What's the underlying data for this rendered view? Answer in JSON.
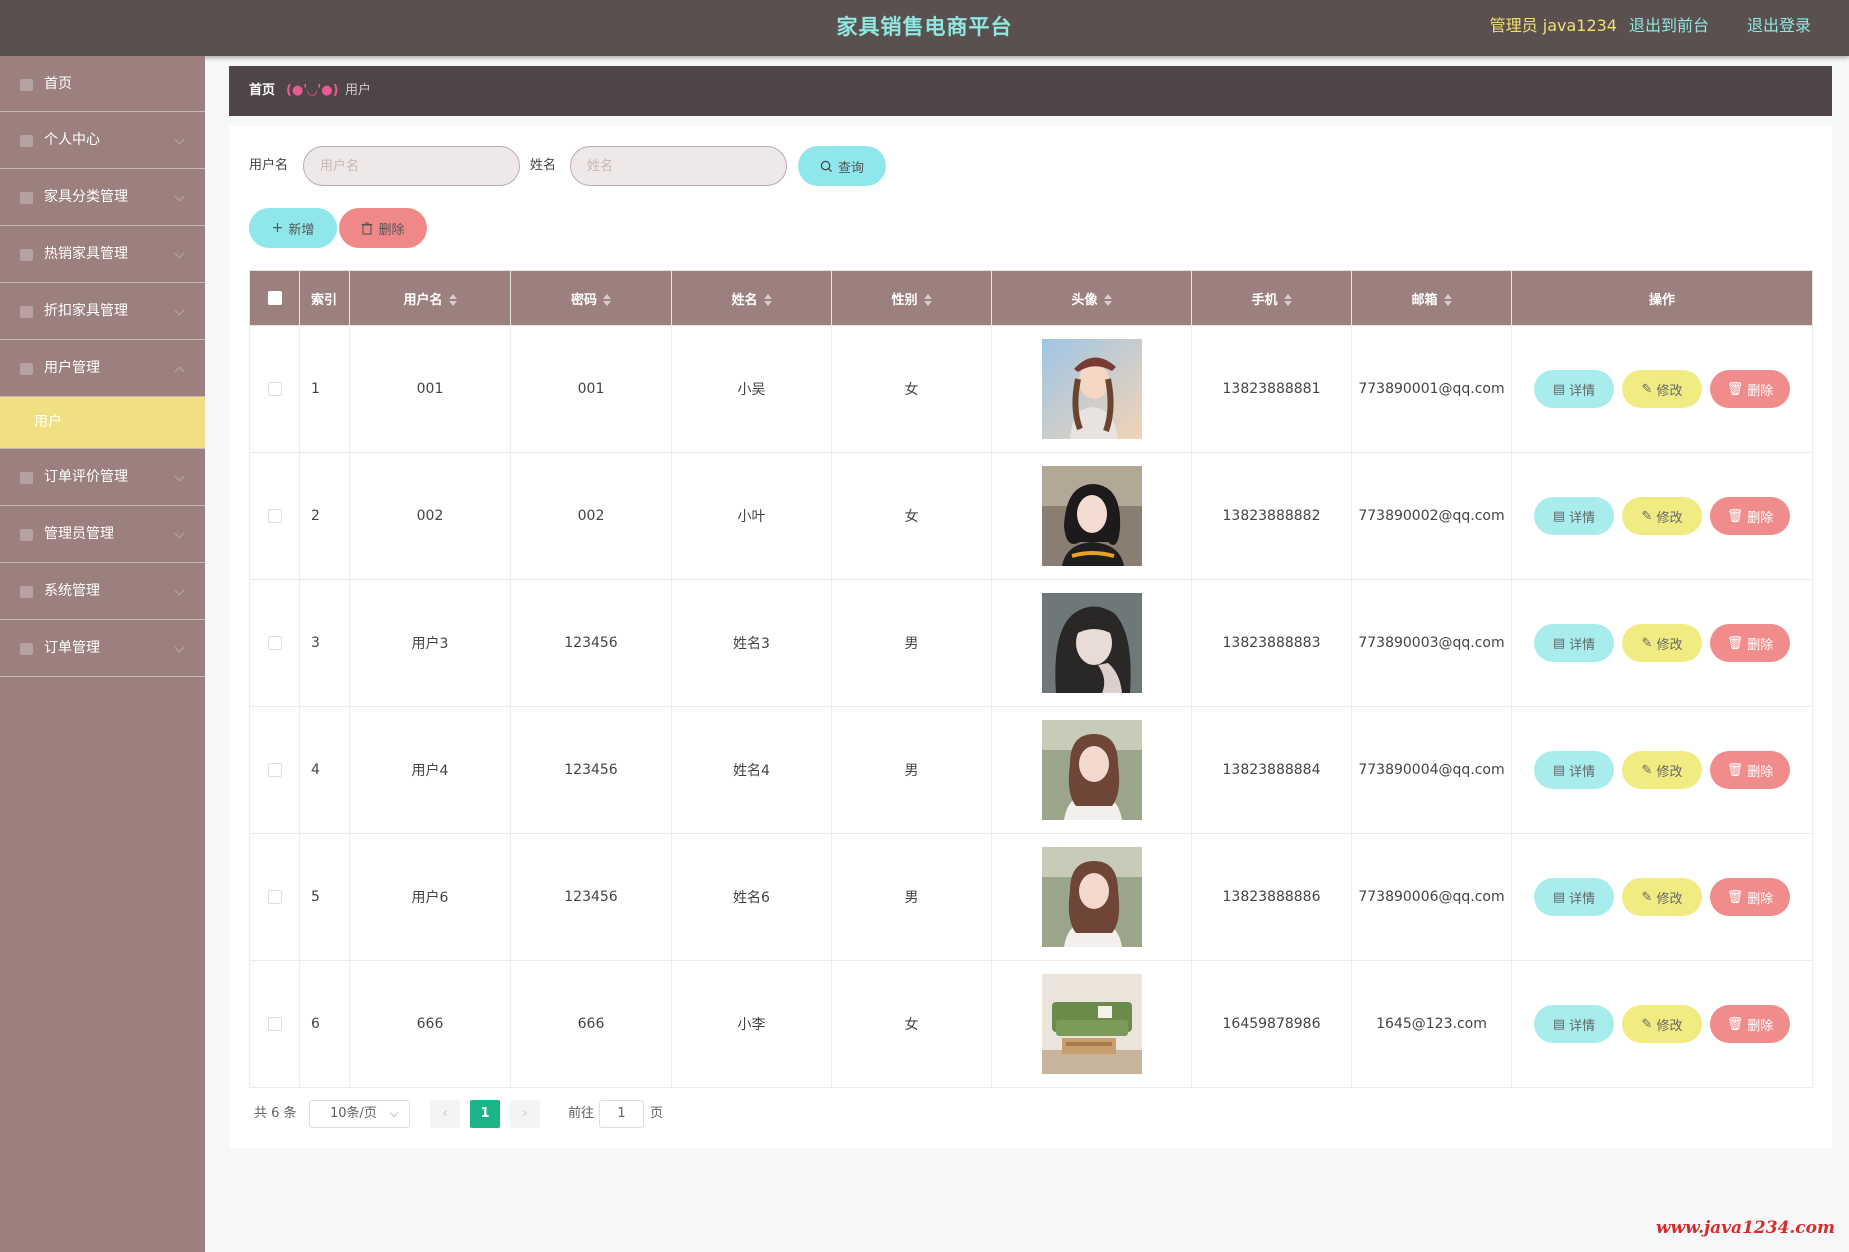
{
  "header": {
    "title": "家具销售电商平台",
    "admin_label": "管理员 java1234",
    "front_link": "退出到前台",
    "logout_link": "退出登录"
  },
  "sidebar": {
    "items": [
      {
        "label": "首页"
      },
      {
        "label": "个人中心"
      },
      {
        "label": "家具分类管理"
      },
      {
        "label": "热销家具管理"
      },
      {
        "label": "折扣家具管理"
      },
      {
        "label": "用户管理"
      },
      {
        "label": "订单评价管理"
      },
      {
        "label": "管理员管理"
      },
      {
        "label": "系统管理"
      },
      {
        "label": "订单管理"
      }
    ],
    "sub_active": "用户"
  },
  "breadcrumb": {
    "home": "首页",
    "separator": "(●'◡'●)",
    "current": "用户"
  },
  "search": {
    "username_label": "用户名",
    "username_placeholder": "用户名",
    "name_label": "姓名",
    "name_placeholder": "姓名",
    "query_label": "查询"
  },
  "actions": {
    "add_label": "新增",
    "delete_label": "删除"
  },
  "table": {
    "headers": {
      "index": "索引",
      "username": "用户名",
      "password": "密码",
      "name": "姓名",
      "gender": "性别",
      "avatar": "头像",
      "phone": "手机",
      "email": "邮箱",
      "ops": "操作"
    },
    "rows": [
      {
        "index": "1",
        "username": "001",
        "password": "001",
        "name": "小吴",
        "gender": "女",
        "phone": "13823888881",
        "email": "773890001@qq.com"
      },
      {
        "index": "2",
        "username": "002",
        "password": "002",
        "name": "小叶",
        "gender": "女",
        "phone": "13823888882",
        "email": "773890002@qq.com"
      },
      {
        "index": "3",
        "username": "用户3",
        "password": "123456",
        "name": "姓名3",
        "gender": "男",
        "phone": "13823888883",
        "email": "773890003@qq.com"
      },
      {
        "index": "4",
        "username": "用户4",
        "password": "123456",
        "name": "姓名4",
        "gender": "男",
        "phone": "13823888884",
        "email": "773890004@qq.com"
      },
      {
        "index": "5",
        "username": "用户6",
        "password": "123456",
        "name": "姓名6",
        "gender": "男",
        "phone": "13823888886",
        "email": "773890006@qq.com"
      },
      {
        "index": "6",
        "username": "666",
        "password": "666",
        "name": "小李",
        "gender": "女",
        "phone": "16459878986",
        "email": "1645@123.com"
      }
    ],
    "op_detail": "详情",
    "op_edit": "修改",
    "op_delete": "删除"
  },
  "pagination": {
    "total": "共 6 条",
    "page_size": "10条/页",
    "current_page": "1",
    "goto_label": "前往",
    "goto_value": "1",
    "page_suffix": "页"
  },
  "watermark": "www.java1234.com",
  "colors": {
    "header_bg": "#5a5050",
    "sidebar_bg": "#9b807e",
    "accent_teal": "#8fe7eb",
    "accent_yellow": "#f0e083",
    "accent_red": "#f0888a",
    "page_active": "#1bb486"
  }
}
